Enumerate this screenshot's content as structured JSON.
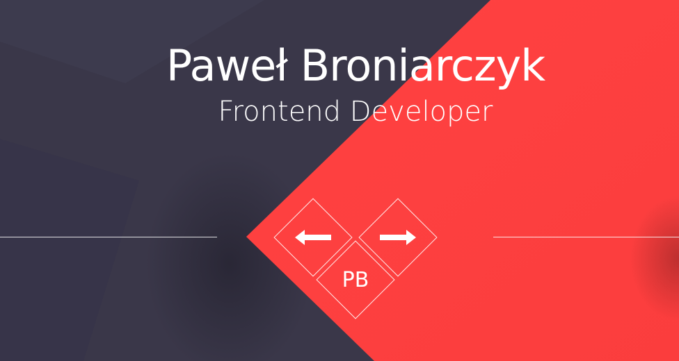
{
  "header": {
    "name": "Paweł Broniarczyk",
    "role": "Frontend Developer"
  },
  "nav": {
    "prev_icon": "arrow-left-icon",
    "next_icon": "arrow-right-icon",
    "logo_text": "PB"
  },
  "colors": {
    "background": "#3a3749",
    "accent": "#fe4040",
    "text": "#ffffff"
  }
}
